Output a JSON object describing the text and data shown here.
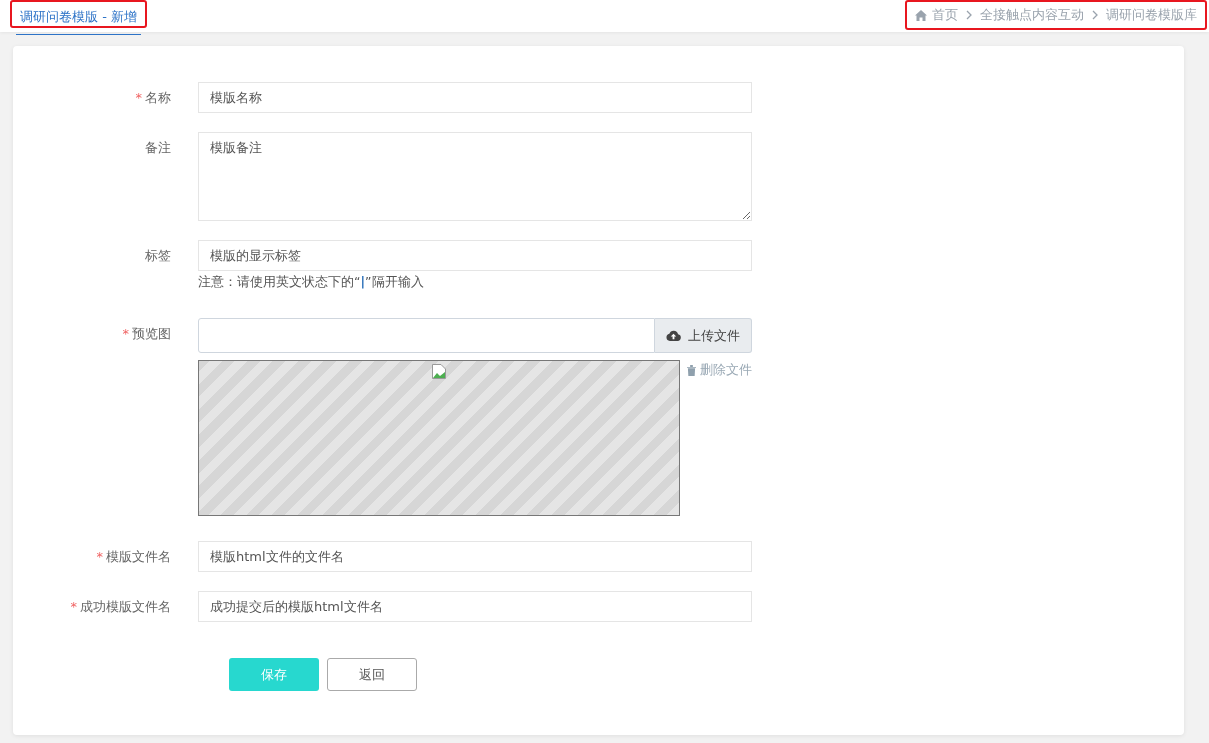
{
  "tab": {
    "label": "调研问卷模版 - 新增",
    "selected": true,
    "highlighted": true
  },
  "breadcrumb": {
    "highlighted": true,
    "items": [
      "首页",
      "全接触点内容互动",
      "调研问卷模版库"
    ]
  },
  "form": {
    "required_mark": "*",
    "fields": [
      {
        "kind": "input",
        "label": "名称",
        "required": true,
        "placeholder": "模版名称"
      },
      {
        "kind": "textarea",
        "label": "备注",
        "required": false,
        "placeholder": "模版备注"
      },
      {
        "kind": "input",
        "label": "标签",
        "required": false,
        "placeholder": "模版的显示标签",
        "note": "注意：请使用英文状态下的“**|**”隔开输入"
      },
      {
        "kind": "upload",
        "label": "预览图",
        "required": true,
        "button": "上传文件",
        "delete_link": "删除文件"
      },
      {
        "kind": "input",
        "label": "模版文件名",
        "required": true,
        "placeholder": "模版html文件的文件名"
      },
      {
        "kind": "input",
        "label": "成功模版文件名",
        "required": true,
        "placeholder": "成功提交后的模版html文件名"
      }
    ],
    "buttons": [
      {
        "kind": "primary",
        "label": "保存"
      },
      {
        "kind": "default",
        "label": "返回"
      }
    ]
  }
}
